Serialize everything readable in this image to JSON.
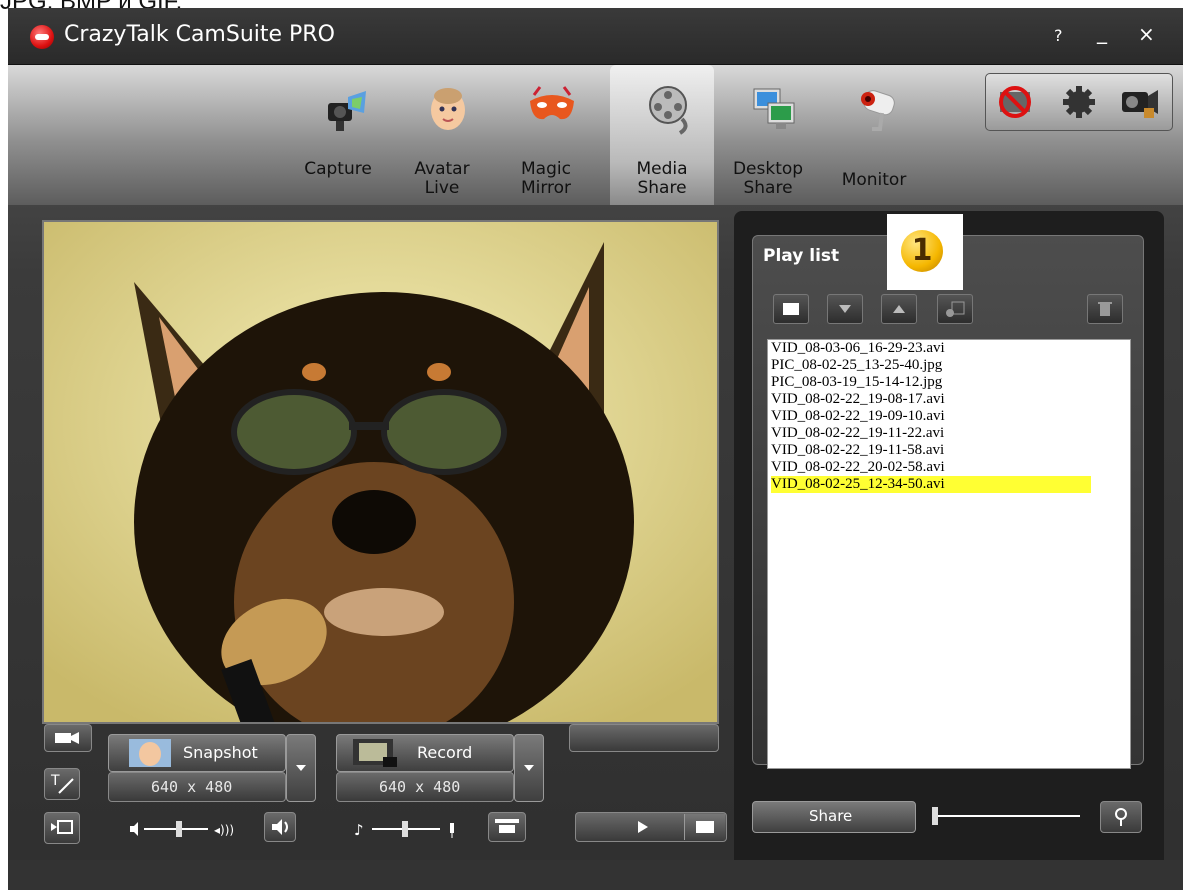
{
  "caption": "JPG, BMP и GIF.",
  "window": {
    "title": "CrazyTalk CamSuite PRO",
    "help": "?",
    "minimize": "_",
    "close": "×"
  },
  "tabs": [
    {
      "label": "Capture",
      "icon": "camera-icon"
    },
    {
      "label": "Avatar\nLive",
      "icon": "baby-avatar-icon"
    },
    {
      "label": "Magic\nMirror",
      "icon": "mask-icon"
    },
    {
      "label": "Media\nShare",
      "icon": "film-reel-icon",
      "active": true
    },
    {
      "label": "Desktop\nShare",
      "icon": "desktop-icon"
    },
    {
      "label": "Monitor",
      "icon": "security-camera-icon"
    }
  ],
  "toolbox": [
    "no-share-icon",
    "gear-icon",
    "webcam-icon"
  ],
  "controls": {
    "snapshot_label": "Snapshot",
    "snapshot_res": "640 x 480",
    "record_label": "Record",
    "record_res": "640 x 480"
  },
  "playlist": {
    "title": "Play list",
    "callout": "1",
    "files": [
      "VID_08-03-06_16-29-23.avi",
      "PIC_08-02-25_13-25-40.jpg",
      "PIC_08-03-19_15-14-12.jpg",
      "VID_08-02-22_19-08-17.avi",
      "VID_08-02-22_19-09-10.avi",
      "VID_08-02-22_19-11-22.avi",
      "VID_08-02-22_19-11-58.avi",
      "VID_08-02-22_20-02-58.avi",
      "VID_08-02-25_12-34-50.avi"
    ],
    "selected_index": 8,
    "share_label": "Share"
  },
  "colors": {
    "selection": "#ffff33",
    "title_bar": "#2f2f2f"
  }
}
